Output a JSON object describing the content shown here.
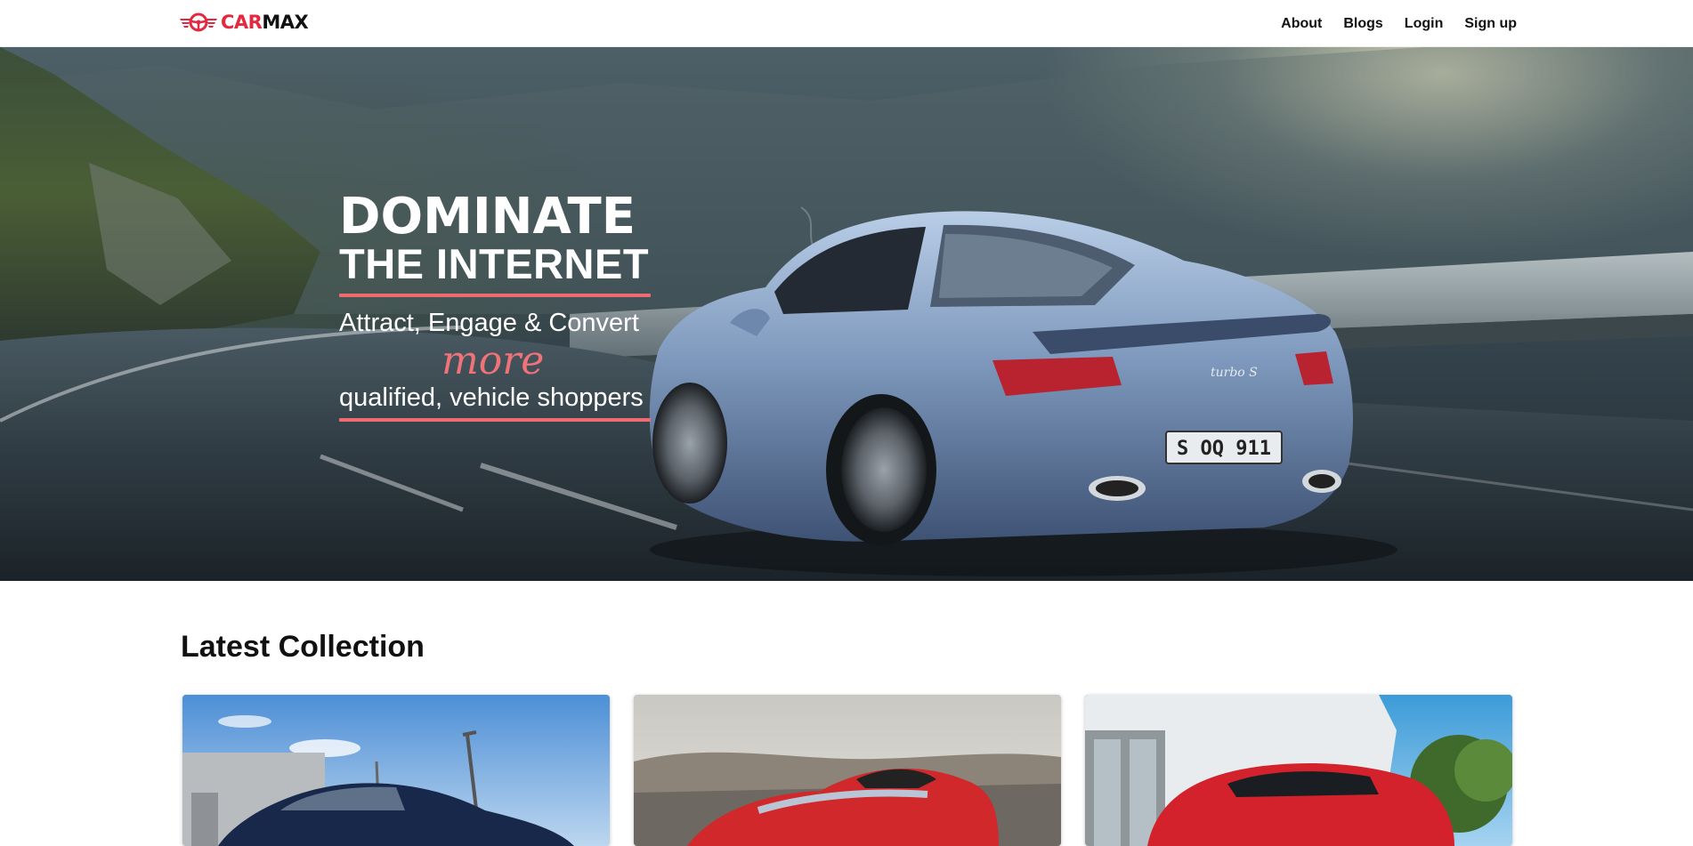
{
  "brand": {
    "name_part1": "CAR",
    "name_part2": "MAX",
    "logo_icon": "steering-wheel-wings-icon",
    "accent_color": "#e4283f"
  },
  "nav": {
    "links": [
      {
        "label": "About"
      },
      {
        "label": "Blogs"
      },
      {
        "label": "Login"
      },
      {
        "label": "Sign up"
      }
    ]
  },
  "hero": {
    "title": "DOMINATE",
    "subtitle": "THE INTERNET",
    "line1": "Attract, Engage & Convert",
    "emphasis": "more",
    "line2": "qualified, vehicle shoppers",
    "accent_color": "#ef6b72",
    "license_plate": "S OQ 911",
    "badge": "turbo S"
  },
  "latest": {
    "title": "Latest Collection",
    "cards": [
      {
        "image": "dark-blue-sedan-photo"
      },
      {
        "image": "red-convertible-sports-car-photo"
      },
      {
        "image": "red-suv-photo"
      }
    ]
  }
}
